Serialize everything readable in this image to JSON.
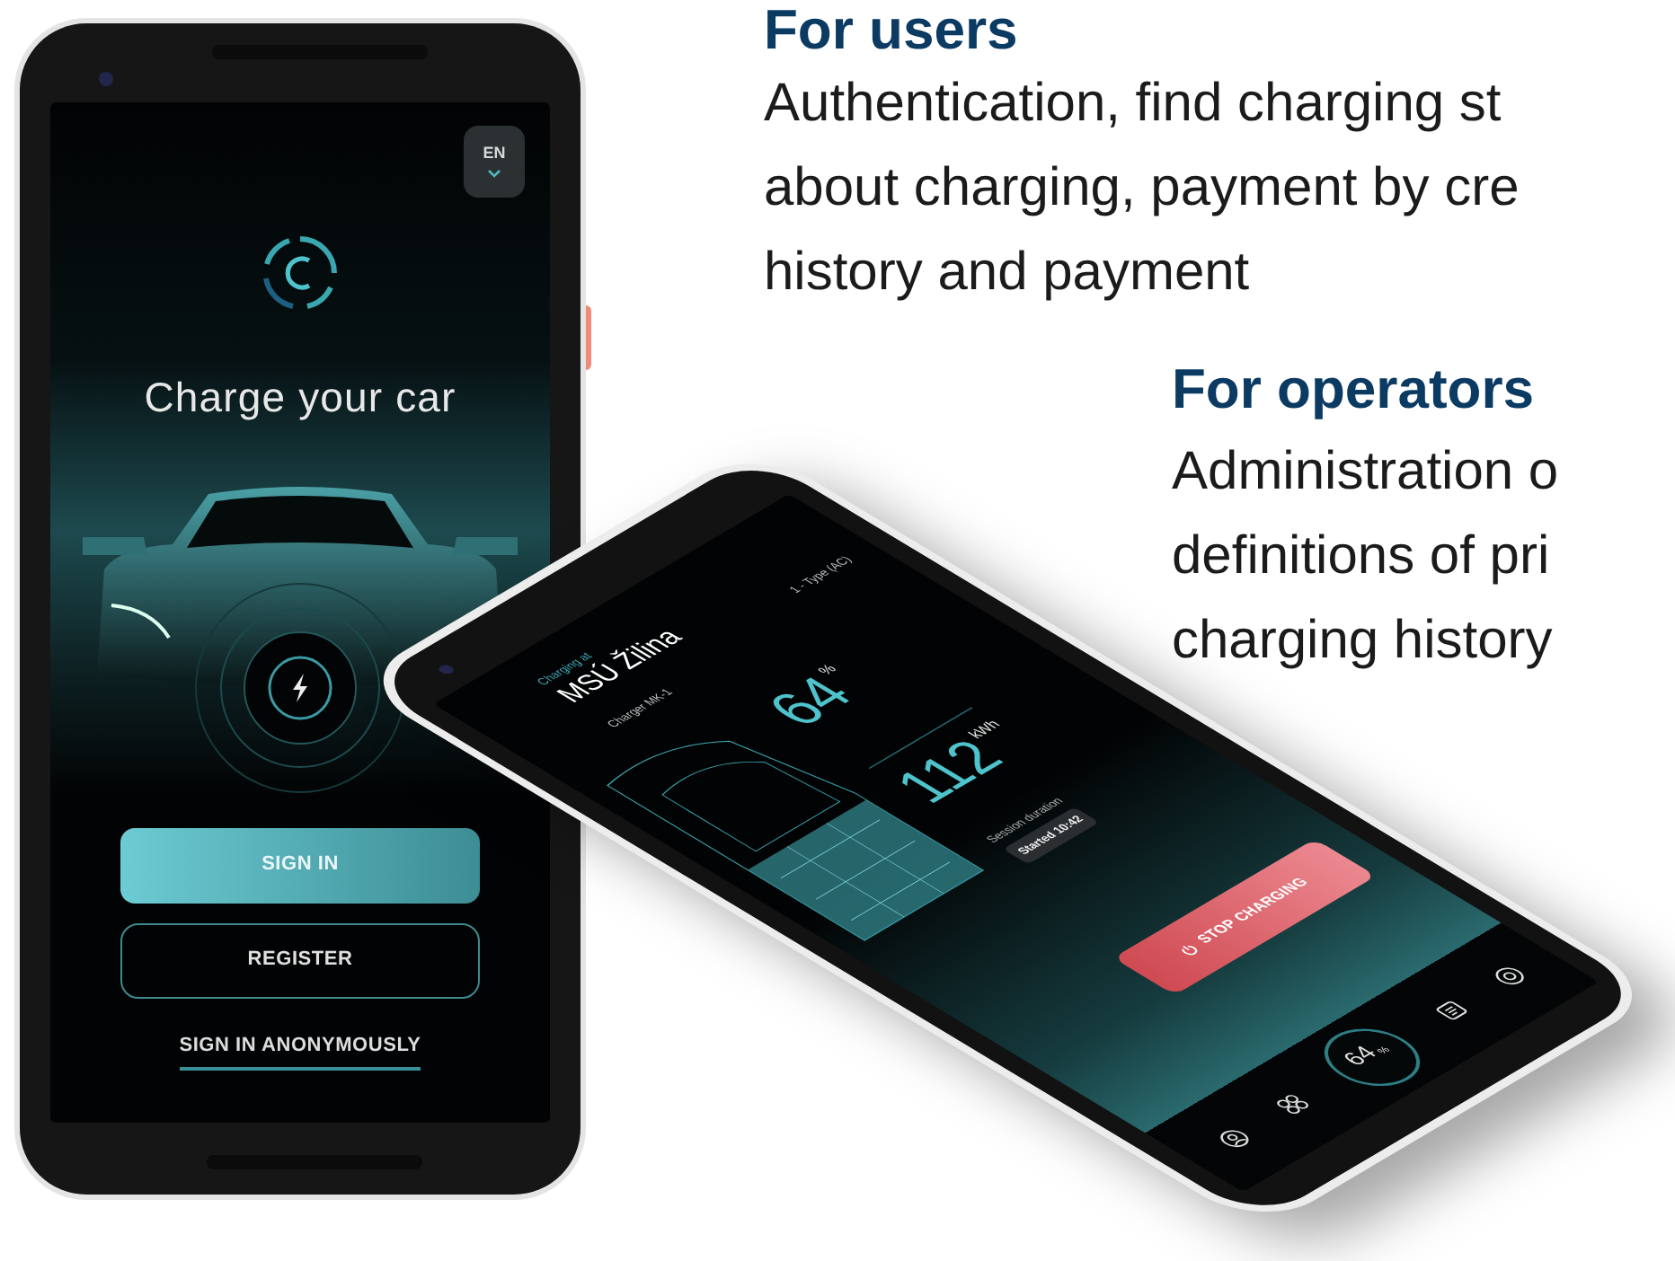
{
  "left_phone": {
    "language_button": "EN",
    "title": "Charge your car",
    "buttons": [
      {
        "label": "SIGN IN",
        "kind": "filled"
      },
      {
        "label": "REGISTER",
        "kind": "outlined"
      }
    ],
    "link": "SIGN IN ANONYMOUSLY"
  },
  "right_phone": {
    "caption": "Charging at",
    "station": "MSÚ Žilina",
    "charger": "Charger MK-1",
    "connector": "1 - Type (AC)",
    "charge": {
      "value": "64",
      "unit": "%"
    },
    "energy": {
      "value": "112",
      "unit": "kWh"
    },
    "session_label": "Session duration",
    "session_start": "Started 10:42",
    "stop_button": "STOP CHARGING",
    "nav": [
      {
        "kind": "account"
      },
      {
        "kind": "grid"
      },
      {
        "kind": "gauge",
        "value": "64",
        "unit": "%"
      },
      {
        "kind": "list"
      },
      {
        "kind": "support"
      }
    ]
  },
  "sections": [
    {
      "heading": "For users",
      "lines": [
        "Authentication, find charging st",
        "about charging, payment by cre",
        "history and payment"
      ]
    },
    {
      "heading": "For operators",
      "lines": [
        "Administration o",
        "definitions of pri",
        "charging history"
      ]
    }
  ]
}
